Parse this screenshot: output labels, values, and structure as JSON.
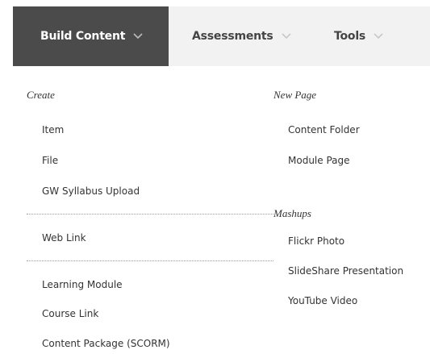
{
  "nav": {
    "tabs": [
      {
        "label": "Build Content",
        "active": true
      },
      {
        "label": "Assessments",
        "active": false
      },
      {
        "label": "Tools",
        "active": false
      }
    ]
  },
  "menu": {
    "left": {
      "heading": "Create",
      "items": [
        "Item",
        "File",
        "GW Syllabus Upload",
        "Web Link",
        "Learning Module",
        "Course Link",
        "Content Package (SCORM)"
      ]
    },
    "right": {
      "new_page": {
        "heading": "New Page",
        "items": [
          "Content Folder",
          "Module Page"
        ]
      },
      "mashups": {
        "heading": "Mashups",
        "items": [
          "Flickr Photo",
          "SlideShare Presentation",
          "YouTube Video"
        ]
      }
    }
  },
  "colors": {
    "active_tab_bg": "#4b4b4b",
    "topbar_bg": "#f2f2f2",
    "chevron_active": "#bbbbbb",
    "chevron_inactive": "#c8c8c8"
  },
  "icons": [
    "chevron-down-icon"
  ]
}
